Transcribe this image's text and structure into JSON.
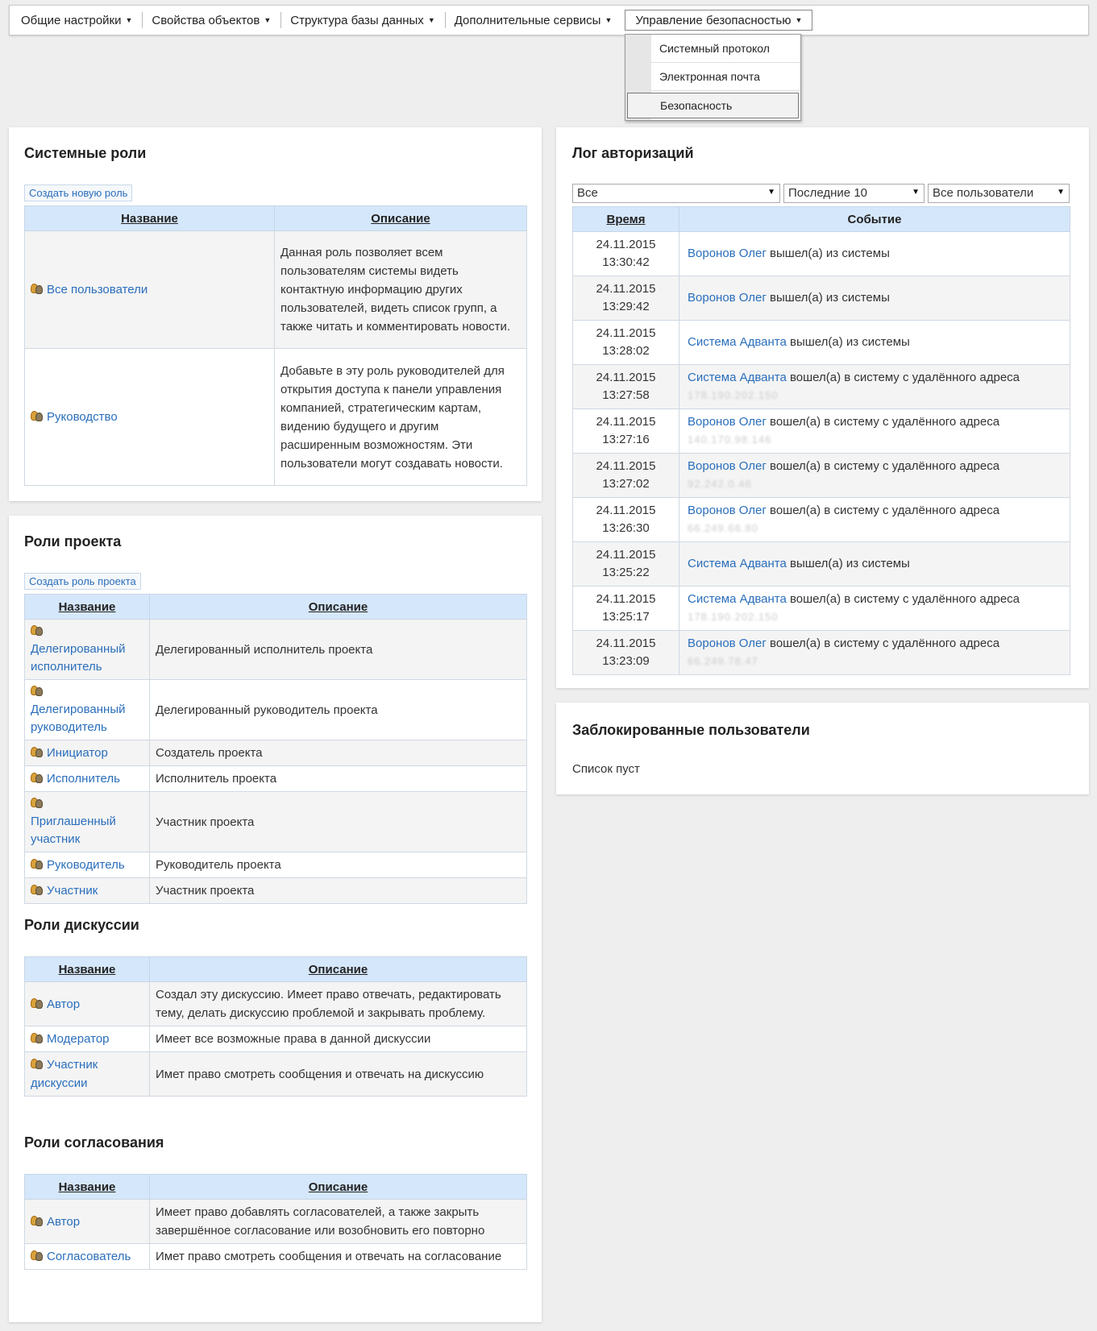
{
  "menu": {
    "items": [
      {
        "label": "Общие настройки"
      },
      {
        "label": "Свойства объектов"
      },
      {
        "label": "Структура базы данных"
      },
      {
        "label": "Дополнительные сервисы"
      },
      {
        "label": "Управление безопасностью"
      }
    ],
    "dropdown": [
      "Системный протокол",
      "Электронная почта",
      "Безопасность"
    ]
  },
  "system_roles": {
    "title": "Системные роли",
    "create_button": "Создать новую роль",
    "col_name": "Название",
    "col_desc": "Описание",
    "rows": [
      {
        "name": "Все пользователи",
        "desc": "Данная роль позволяет всем пользователям системы видеть контактную информацию других пользователей, видеть список групп, а также читать и комментировать новости."
      },
      {
        "name": "Руководство",
        "desc": "Добавьте в эту роль руководителей для открытия доступа к панели управления компанией, стратегическим картам, видению будущего и другим расширенным возможностям. Эти пользователи могут создавать новости."
      }
    ]
  },
  "project_roles": {
    "title": "Роли проекта",
    "create_button": "Создать роль проекта",
    "col_name": "Название",
    "col_desc": "Описание",
    "rows": [
      {
        "name": "Делегированный исполнитель",
        "desc": "Делегированный исполнитель проекта"
      },
      {
        "name": "Делегированный руководитель",
        "desc": "Делегированный руководитель проекта"
      },
      {
        "name": "Инициатор",
        "desc": "Создатель проекта"
      },
      {
        "name": "Исполнитель",
        "desc": "Исполнитель проекта"
      },
      {
        "name": "Приглашенный участник",
        "desc": "Участник проекта"
      },
      {
        "name": "Руководитель",
        "desc": "Руководитель проекта"
      },
      {
        "name": "Участник",
        "desc": "Участник проекта"
      }
    ]
  },
  "discussion_roles": {
    "title": "Роли дискуссии",
    "col_name": "Название",
    "col_desc": "Описание",
    "rows": [
      {
        "name": "Автор",
        "desc": "Создал эту дискуссию. Имеет право отвечать, редактировать тему, делать дискуссию проблемой и закрывать проблему."
      },
      {
        "name": "Модератор",
        "desc": "Имеет все возможные права в данной дискуссии"
      },
      {
        "name": "Участник дискуссии",
        "desc": "Имет право смотреть сообщения и отвечать на дискуссию"
      }
    ]
  },
  "approval_roles": {
    "title": "Роли согласования",
    "col_name": "Название",
    "col_desc": "Описание",
    "rows": [
      {
        "name": "Автор",
        "desc": "Имеет право добавлять согласователей, а также закрыть завершённое согласование или возобновить его повторно"
      },
      {
        "name": "Согласователь",
        "desc": "Имет право смотреть сообщения и отвечать на согласование"
      }
    ]
  },
  "auth_log": {
    "title": "Лог авторизаций",
    "filter_type": "Все",
    "filter_count": "Последние 10",
    "filter_users": "Все пользователи",
    "col_time": "Время",
    "col_event": "Событие",
    "rows": [
      {
        "date": "24.11.2015",
        "time": "13:30:42",
        "user": "Воронов Олег",
        "event": "вышел(а) из системы",
        "ip": ""
      },
      {
        "date": "24.11.2015",
        "time": "13:29:42",
        "user": "Воронов Олег",
        "event": "вышел(а) из системы",
        "ip": ""
      },
      {
        "date": "24.11.2015",
        "time": "13:28:02",
        "user": "Система Адванта",
        "event": "вышел(а) из системы",
        "ip": ""
      },
      {
        "date": "24.11.2015",
        "time": "13:27:58",
        "user": "Система Адванта",
        "event": "вошел(а) в систему с удалённого адреса",
        "ip": "178.190.202.150"
      },
      {
        "date": "24.11.2015",
        "time": "13:27:16",
        "user": "Воронов Олег",
        "event": "вошел(а) в систему с удалённого адреса",
        "ip": "140.170.98.146"
      },
      {
        "date": "24.11.2015",
        "time": "13:27:02",
        "user": "Воронов Олег",
        "event": "вошел(а) в систему с удалённого адреса",
        "ip": "92.242.0.46"
      },
      {
        "date": "24.11.2015",
        "time": "13:26:30",
        "user": "Воронов Олег",
        "event": "вошел(а) в систему с удалённого адреса",
        "ip": "66.249.66.80"
      },
      {
        "date": "24.11.2015",
        "time": "13:25:22",
        "user": "Система Адванта",
        "event": "вышел(а) из системы",
        "ip": ""
      },
      {
        "date": "24.11.2015",
        "time": "13:25:17",
        "user": "Система Адванта",
        "event": "вошел(а) в систему с удалённого адреса",
        "ip": "178.190.202.150"
      },
      {
        "date": "24.11.2015",
        "time": "13:23:09",
        "user": "Воронов Олег",
        "event": "вошел(а) в систему с удалённого адреса",
        "ip": "66.249.78.47"
      }
    ]
  },
  "blocked_users": {
    "title": "Заблокированные пользователи",
    "empty": "Список пуст"
  }
}
